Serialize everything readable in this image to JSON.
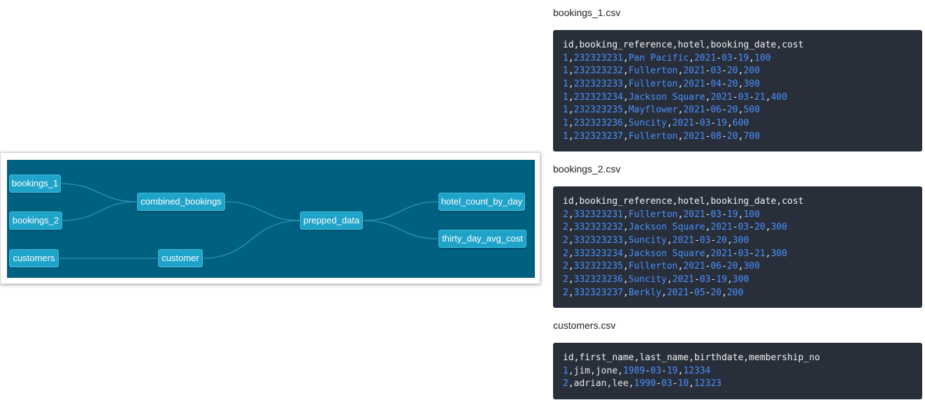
{
  "dag": {
    "nodes": [
      {
        "id": "bookings_1",
        "label": "bookings_1"
      },
      {
        "id": "bookings_2",
        "label": "bookings_2"
      },
      {
        "id": "customers",
        "label": "customers"
      },
      {
        "id": "combined_bookings",
        "label": "combined_bookings"
      },
      {
        "id": "customer",
        "label": "customer"
      },
      {
        "id": "prepped_data",
        "label": "prepped_data"
      },
      {
        "id": "hotel_count_by_day",
        "label": "hotel_count_by_day"
      },
      {
        "id": "thirty_day_avg_cost",
        "label": "thirty_day_avg_cost"
      }
    ],
    "edges": [
      [
        "bookings_1",
        "combined_bookings"
      ],
      [
        "bookings_2",
        "combined_bookings"
      ],
      [
        "customers",
        "customer"
      ],
      [
        "combined_bookings",
        "prepped_data"
      ],
      [
        "customer",
        "prepped_data"
      ],
      [
        "prepped_data",
        "hotel_count_by_day"
      ],
      [
        "prepped_data",
        "thirty_day_avg_cost"
      ]
    ]
  },
  "files": [
    {
      "title": "bookings_1.csv",
      "header": "id,booking_reference,hotel,booking_date,cost",
      "rows": [
        [
          "1",
          "232323231",
          "Pan Pacific",
          "2021",
          "03",
          "19",
          "100"
        ],
        [
          "1",
          "232323232",
          "Fullerton",
          "2021",
          "03",
          "20",
          "200"
        ],
        [
          "1",
          "232323233",
          "Fullerton",
          "2021",
          "04",
          "20",
          "300"
        ],
        [
          "1",
          "232323234",
          "Jackson Square",
          "2021",
          "03",
          "21",
          "400"
        ],
        [
          "1",
          "232323235",
          "Mayflower",
          "2021",
          "06",
          "20",
          "500"
        ],
        [
          "1",
          "232323236",
          "Suncity",
          "2021",
          "03",
          "19",
          "600"
        ],
        [
          "1",
          "232323237",
          "Fullerton",
          "2021",
          "08",
          "20",
          "700"
        ]
      ]
    },
    {
      "title": "bookings_2.csv",
      "header": "id,booking_reference,hotel,booking_date,cost",
      "rows": [
        [
          "2",
          "332323231",
          "Fullerton",
          "2021",
          "03",
          "19",
          "100"
        ],
        [
          "2",
          "332323232",
          "Jackson Square",
          "2021",
          "03",
          "20",
          "300"
        ],
        [
          "2",
          "332323233",
          "Suncity",
          "2021",
          "03",
          "20",
          "300"
        ],
        [
          "2",
          "332323234",
          "Jackson Square",
          "2021",
          "03",
          "21",
          "300"
        ],
        [
          "2",
          "332323235",
          "Fullerton",
          "2021",
          "06",
          "20",
          "300"
        ],
        [
          "2",
          "332323236",
          "Suncity",
          "2021",
          "03",
          "19",
          "300"
        ],
        [
          "2",
          "332323237",
          "Berkly",
          "2021",
          "05",
          "20",
          "200"
        ]
      ]
    },
    {
      "title": "customers.csv",
      "header": "id,first_name,last_name,birthdate,membership_no",
      "rows": [
        [
          "1",
          "jim",
          "jone",
          "1989",
          "03",
          "19",
          "12334"
        ],
        [
          "2",
          "adrian",
          "lee",
          "1990",
          "03",
          "10",
          "12323"
        ]
      ]
    }
  ],
  "colors": {
    "dag_background": "#006080",
    "node_fill": "#1fa3c9",
    "code_background": "#282f3a",
    "code_accent": "#4a90ff"
  }
}
